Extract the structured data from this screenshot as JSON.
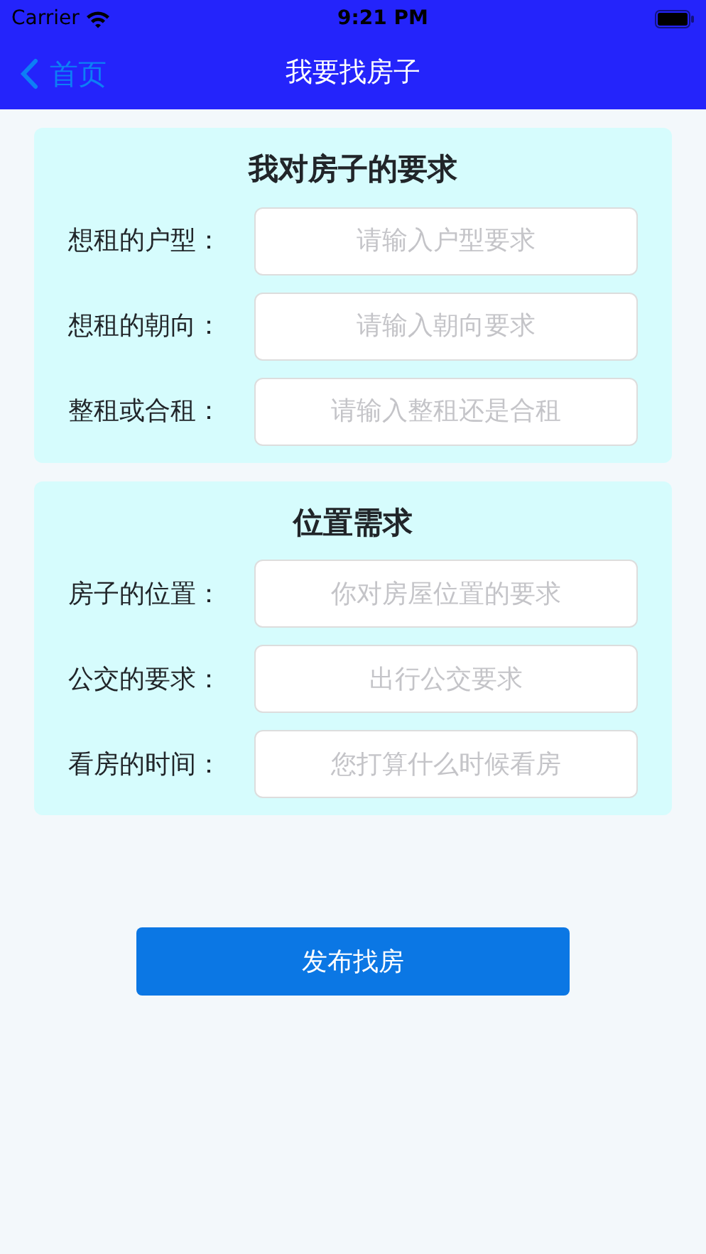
{
  "status_bar": {
    "carrier": "Carrier",
    "time": "9:21 PM"
  },
  "nav_bar": {
    "back_label": "首页",
    "title": "我要找房子"
  },
  "sections": [
    {
      "title": "我对房子的要求",
      "fields": [
        {
          "label": "想租的户型：",
          "placeholder": "请输入户型要求"
        },
        {
          "label": "想租的朝向：",
          "placeholder": "请输入朝向要求"
        },
        {
          "label": "整租或合租：",
          "placeholder": "请输入整租还是合租"
        }
      ]
    },
    {
      "title": "位置需求",
      "fields": [
        {
          "label": "房子的位置：",
          "placeholder": "你对房屋位置的要求"
        },
        {
          "label": "公交的要求：",
          "placeholder": "出行公交要求"
        },
        {
          "label": "看房的时间：",
          "placeholder": "您打算什么时候看房"
        }
      ]
    }
  ],
  "submit_button": "发布找房"
}
